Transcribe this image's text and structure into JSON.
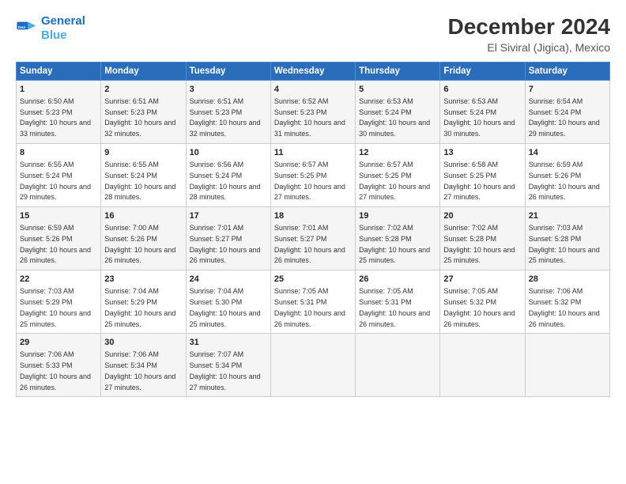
{
  "header": {
    "logo_line1": "General",
    "logo_line2": "Blue",
    "main_title": "December 2024",
    "sub_title": "El Siviral (Jigica), Mexico"
  },
  "days_of_week": [
    "Sunday",
    "Monday",
    "Tuesday",
    "Wednesday",
    "Thursday",
    "Friday",
    "Saturday"
  ],
  "weeks": [
    [
      {
        "day": "1",
        "sunrise": "6:50 AM",
        "sunset": "5:23 PM",
        "daylight": "10 hours and 33 minutes."
      },
      {
        "day": "2",
        "sunrise": "6:51 AM",
        "sunset": "5:23 PM",
        "daylight": "10 hours and 32 minutes."
      },
      {
        "day": "3",
        "sunrise": "6:51 AM",
        "sunset": "5:23 PM",
        "daylight": "10 hours and 32 minutes."
      },
      {
        "day": "4",
        "sunrise": "6:52 AM",
        "sunset": "5:23 PM",
        "daylight": "10 hours and 31 minutes."
      },
      {
        "day": "5",
        "sunrise": "6:53 AM",
        "sunset": "5:24 PM",
        "daylight": "10 hours and 30 minutes."
      },
      {
        "day": "6",
        "sunrise": "6:53 AM",
        "sunset": "5:24 PM",
        "daylight": "10 hours and 30 minutes."
      },
      {
        "day": "7",
        "sunrise": "6:54 AM",
        "sunset": "5:24 PM",
        "daylight": "10 hours and 29 minutes."
      }
    ],
    [
      {
        "day": "8",
        "sunrise": "6:55 AM",
        "sunset": "5:24 PM",
        "daylight": "10 hours and 29 minutes."
      },
      {
        "day": "9",
        "sunrise": "6:55 AM",
        "sunset": "5:24 PM",
        "daylight": "10 hours and 28 minutes."
      },
      {
        "day": "10",
        "sunrise": "6:56 AM",
        "sunset": "5:24 PM",
        "daylight": "10 hours and 28 minutes."
      },
      {
        "day": "11",
        "sunrise": "6:57 AM",
        "sunset": "5:25 PM",
        "daylight": "10 hours and 27 minutes."
      },
      {
        "day": "12",
        "sunrise": "6:57 AM",
        "sunset": "5:25 PM",
        "daylight": "10 hours and 27 minutes."
      },
      {
        "day": "13",
        "sunrise": "6:58 AM",
        "sunset": "5:25 PM",
        "daylight": "10 hours and 27 minutes."
      },
      {
        "day": "14",
        "sunrise": "6:59 AM",
        "sunset": "5:26 PM",
        "daylight": "10 hours and 26 minutes."
      }
    ],
    [
      {
        "day": "15",
        "sunrise": "6:59 AM",
        "sunset": "5:26 PM",
        "daylight": "10 hours and 26 minutes."
      },
      {
        "day": "16",
        "sunrise": "7:00 AM",
        "sunset": "5:26 PM",
        "daylight": "10 hours and 26 minutes."
      },
      {
        "day": "17",
        "sunrise": "7:01 AM",
        "sunset": "5:27 PM",
        "daylight": "10 hours and 26 minutes."
      },
      {
        "day": "18",
        "sunrise": "7:01 AM",
        "sunset": "5:27 PM",
        "daylight": "10 hours and 26 minutes."
      },
      {
        "day": "19",
        "sunrise": "7:02 AM",
        "sunset": "5:28 PM",
        "daylight": "10 hours and 25 minutes."
      },
      {
        "day": "20",
        "sunrise": "7:02 AM",
        "sunset": "5:28 PM",
        "daylight": "10 hours and 25 minutes."
      },
      {
        "day": "21",
        "sunrise": "7:03 AM",
        "sunset": "5:28 PM",
        "daylight": "10 hours and 25 minutes."
      }
    ],
    [
      {
        "day": "22",
        "sunrise": "7:03 AM",
        "sunset": "5:29 PM",
        "daylight": "10 hours and 25 minutes."
      },
      {
        "day": "23",
        "sunrise": "7:04 AM",
        "sunset": "5:29 PM",
        "daylight": "10 hours and 25 minutes."
      },
      {
        "day": "24",
        "sunrise": "7:04 AM",
        "sunset": "5:30 PM",
        "daylight": "10 hours and 25 minutes."
      },
      {
        "day": "25",
        "sunrise": "7:05 AM",
        "sunset": "5:31 PM",
        "daylight": "10 hours and 26 minutes."
      },
      {
        "day": "26",
        "sunrise": "7:05 AM",
        "sunset": "5:31 PM",
        "daylight": "10 hours and 26 minutes."
      },
      {
        "day": "27",
        "sunrise": "7:05 AM",
        "sunset": "5:32 PM",
        "daylight": "10 hours and 26 minutes."
      },
      {
        "day": "28",
        "sunrise": "7:06 AM",
        "sunset": "5:32 PM",
        "daylight": "10 hours and 26 minutes."
      }
    ],
    [
      {
        "day": "29",
        "sunrise": "7:06 AM",
        "sunset": "5:33 PM",
        "daylight": "10 hours and 26 minutes."
      },
      {
        "day": "30",
        "sunrise": "7:06 AM",
        "sunset": "5:34 PM",
        "daylight": "10 hours and 27 minutes."
      },
      {
        "day": "31",
        "sunrise": "7:07 AM",
        "sunset": "5:34 PM",
        "daylight": "10 hours and 27 minutes."
      },
      null,
      null,
      null,
      null
    ]
  ],
  "labels": {
    "sunrise": "Sunrise:",
    "sunset": "Sunset:",
    "daylight": "Daylight:"
  }
}
